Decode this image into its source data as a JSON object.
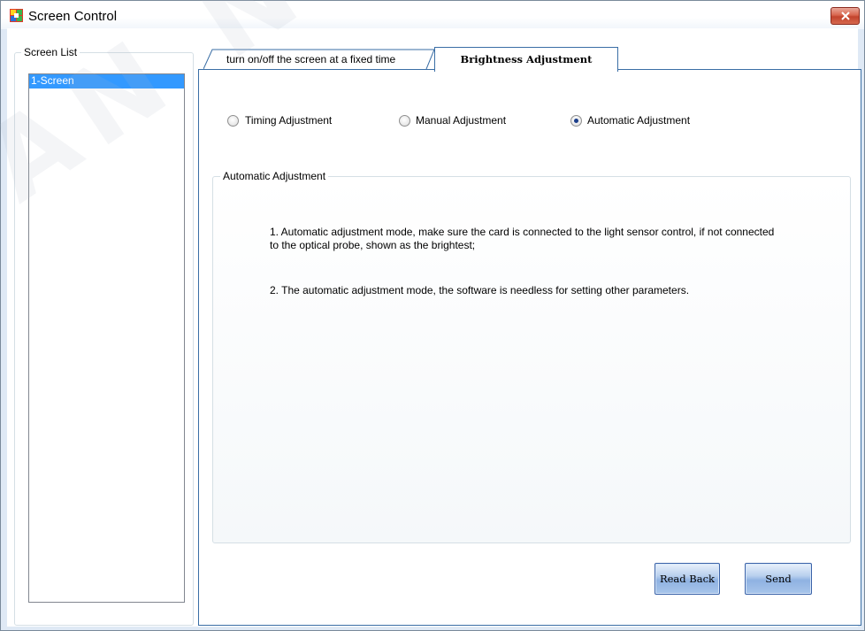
{
  "window": {
    "title": "Screen Control",
    "close_icon": "close-x"
  },
  "screen_list": {
    "label": "Screen List",
    "items": [
      "1-Screen"
    ],
    "selected": "1-Screen"
  },
  "tabs": [
    {
      "label": "turn on/off the screen at a fixed time",
      "active": false
    },
    {
      "label": "Brightness Adjustment",
      "active": true
    }
  ],
  "modes": [
    {
      "label": "Timing Adjustment",
      "checked": false
    },
    {
      "label": "Manual Adjustment",
      "checked": false
    },
    {
      "label": "Automatic Adjustment",
      "checked": true
    }
  ],
  "auto_group": {
    "label": "Automatic Adjustment",
    "note_1": "1. Automatic adjustment mode, make sure the card is connected to the light sensor control, if not connected to the optical probe, shown as the brightest;",
    "note_2": "2. The automatic adjustment mode, the software is needless for setting other parameters."
  },
  "buttons": {
    "read_back": "Read Back",
    "send": "Send"
  },
  "watermark": "AN NOVA",
  "colors": {
    "selection": "#3399ff",
    "accent_border": "#3a6ea5",
    "close_red": "#c2432c"
  }
}
